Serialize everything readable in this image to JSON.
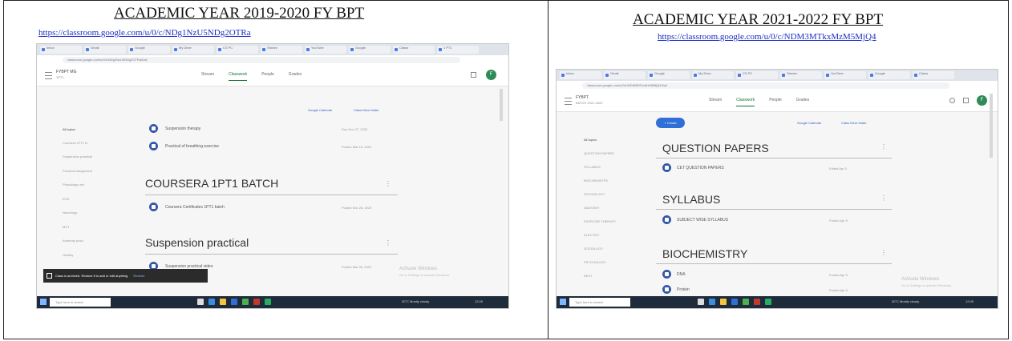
{
  "left_panel": {
    "title": "ACADEMIC YEAR 2019-2020 FY BPT",
    "url": "https://classroom.google.com/u/0/c/NDg1NzU5NDg2OTRa",
    "screenshot": {
      "browser_address": "classroom.google.com/u/0/c/NDg1NzU5NDg2OTRa/t/all",
      "tabs": [
        "Inbox",
        "Gmail",
        "Google",
        "My Drive",
        "CS PC",
        "Stream",
        "YouTube",
        "Google",
        "Classr",
        "1 PT1"
      ],
      "class_name": "FYBPT MG",
      "class_sub": "1PT1",
      "nav_tabs": [
        "Stream",
        "Classwork",
        "People",
        "Grades"
      ],
      "active_tab": "Classwork",
      "calendar_link": "Google Calendar",
      "drive_link": "Class Drive folder",
      "sidebar_items": [
        "All topics",
        "Coursera 1PT1 B",
        "Suspension practical",
        "Practical assignment",
        "Physiology unit",
        "EOS",
        "Neurology",
        "MVT",
        "Anatomy pract",
        "Holiday"
      ],
      "entries_top": [
        {
          "text": "Suspension therapy",
          "date": "Due Nov 27, 2020"
        },
        {
          "text": "Practical of breathing exercise",
          "date": "Posted Mar 15, 2020"
        }
      ],
      "topics": [
        {
          "title": "COURSERA 1PT1 BATCH",
          "entries": [
            {
              "text": "Coursera Certificates 1PT1 batch",
              "date": "Posted Nov 28, 2020"
            }
          ]
        },
        {
          "title": "Suspension practical",
          "entries": [
            {
              "text": "Suspension practical video",
              "date": "Posted Mar 05, 2020"
            }
          ]
        }
      ],
      "toast": {
        "text": "Class is archived. Restore it to add or edit anything",
        "action": "Restore"
      },
      "watermark_1": "Activate Windows",
      "watermark_2": "Go to Settings to activate Windows.",
      "taskbar_search": "Type here to search",
      "tray": "30°C Mostly cloudy",
      "clock": "12:05"
    }
  },
  "right_panel": {
    "title": "ACADEMIC YEAR 2021-2022 FY BPT",
    "url": "https://classroom.google.com/u/0/c/NDM3MTkxMzM5MjQ4",
    "screenshot": {
      "browser_address": "classroom.google.com/u/0/c/NDM3MTkxMzM5MjQ4/t/all",
      "tabs": [
        "Inbox",
        "Gmail",
        "Google",
        "My Drive",
        "CS PC",
        "Stream",
        "YouTube",
        "Google",
        "Classr",
        "1 PT1"
      ],
      "class_name": "FYBPT",
      "class_sub": "BATCH 2021-2022",
      "nav_tabs": [
        "Stream",
        "Classwork",
        "People",
        "Grades"
      ],
      "active_tab": "Classwork",
      "create_label": "+ Create",
      "calendar_link": "Google Calendar",
      "drive_link": "Class Drive folder",
      "sidebar_items": [
        "All topics",
        "QUESTION PAPERS",
        "SYLLABUS",
        "BIOCHEMISTRY",
        "PHYSIOLOGY",
        "ANATOMY",
        "EXERCISE THERAPY",
        "ELECTRO",
        "SOCIOLOGY",
        "PSYCHOLOGY",
        "NEXT"
      ],
      "topics": [
        {
          "title": "QUESTION PAPERS",
          "entries": [
            {
              "text": "CET QUESTION PAPERS",
              "date": "Edited Apr 5"
            }
          ]
        },
        {
          "title": "SYLLABUS",
          "entries": [
            {
              "text": "SUBJECT WISE SYLLABUS",
              "date": "Posted Apr 5"
            }
          ]
        },
        {
          "title": "BIOCHEMISTRY",
          "entries": [
            {
              "text": "DNA",
              "date": "Posted Apr 5"
            },
            {
              "text": "Protein",
              "date": "Posted Apr 5"
            }
          ]
        }
      ],
      "watermark_1": "Activate Windows",
      "watermark_2": "Go to Settings to activate Windows.",
      "taskbar_search": "Type here to search",
      "tray": "30°C Mostly cloudy",
      "clock": "12:05"
    }
  }
}
